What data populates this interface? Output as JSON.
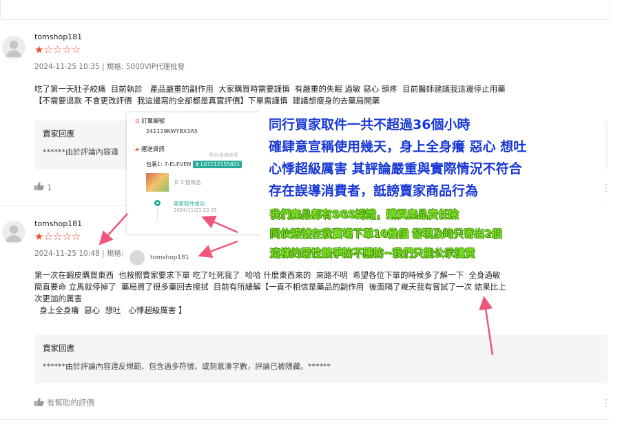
{
  "reviews": [
    {
      "username": "tomshop181",
      "stars": "★☆☆☆☆",
      "date": "2024-11-25 10:35",
      "meta_sep": " | ",
      "variation": "規格: 5000VIP代理批發",
      "content": "吃了第一天肚子絞痛  目前執診   產品嚴重的副作用  大家購買時需要謹慎  有嚴重的失眠 過敏 惡心 頭疼  目前醫師建議我這邊停止用藥\n【不需要退款 不會更改評價  我這邊寫的全部都是真實評價】下單需謹慎  建議想瘦身的去藥局開藥",
      "seller_reply_title": "賣家回應",
      "seller_reply_body": "******由於評論內容違",
      "helpful": "1"
    },
    {
      "username": "tomshop181",
      "stars": "★☆☆☆☆",
      "date": "2024-11-25 10:48",
      "meta_sep": " | ",
      "variation": "規格:",
      "content": "第一次在蝦皮購買東西  也按照賣家要求下單 吃了吐死我了  哈哈 什麼東西來的  來路不明  希望各位下單的時候多了解一下  全身過敏\n簡直要命 立馬就停掉了  藥局買了很多藥回去擦拭  目前有所緩解【一直不相信是藥品的副作用  後面隔了幾天我有嘗試了一次 結果比上\n次更加的厲害\n  身上全身癢  惡心  想吐   心悸超級厲害 】",
      "seller_reply_title": "賣家回應",
      "seller_reply_body": "******由於評論內容違反規範、包含過多符號、或刻意湊字數，評論已被隱藏。******",
      "helpful": "有幫助的評價"
    }
  ],
  "order_screenshot": {
    "order_no_label": "訂單編號",
    "order_no": "241119KWYBX3A5",
    "shipping_label": "運送資訊",
    "package": "包裹1: 7-ELEVEN",
    "tracking": "# L67112155601",
    "item_count": "共 3 個商品",
    "status": "買家取件成功",
    "status_time": "2024/11/23 23:29",
    "faded_text": "點此後續查看"
  },
  "ghost_user": "tomshop181",
  "notice": {
    "blue_lines": [
      "同行買家取件一共不超過36個小時",
      "確肆意宣稱使用幾天，身上全身癢 惡心 想吐",
      "心悸超級厲害 其評論嚴重與實際情況不符合",
      "存在誤導消費者，詆謗賣家商品行為"
    ],
    "green_lines": [
      "我們產品都有SGS認證，購買產品責任險",
      "同伙賬號在我賣場下單10幾個 發現及時只寄出2個",
      "這樣的惡性競爭防不勝防~我們只能公示譴責"
    ]
  },
  "colors": {
    "star": "#ee4d2d",
    "notice_blue": "#1738d6",
    "notice_green": "#7fe32a",
    "arrow": "#f0567a",
    "teal": "#26aa99"
  }
}
